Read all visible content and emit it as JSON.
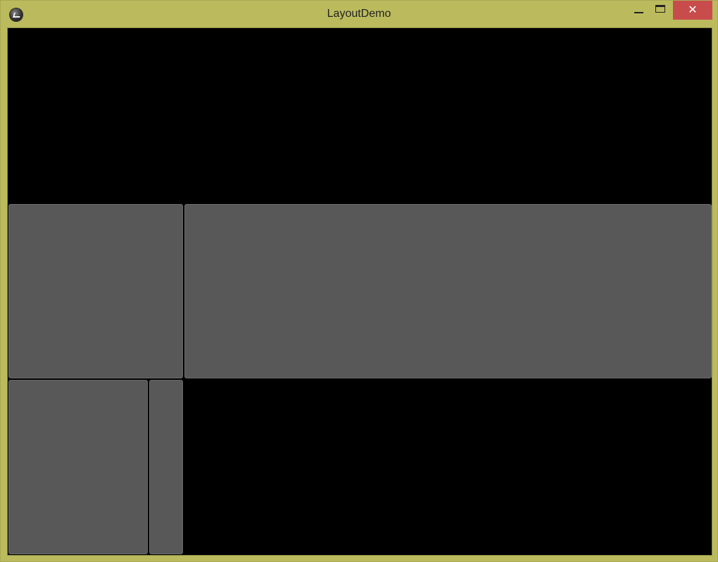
{
  "window": {
    "title": "LayoutDemo",
    "close_glyph": "✕",
    "colors": {
      "frame": "#bbbb5e",
      "close_button": "#c94c4c",
      "client_background": "#000000",
      "panel": "#585858"
    }
  },
  "icons": {
    "app": "app-logo-icon",
    "minimize": "minimize-icon",
    "maximize": "maximize-icon",
    "close": "close-icon"
  }
}
